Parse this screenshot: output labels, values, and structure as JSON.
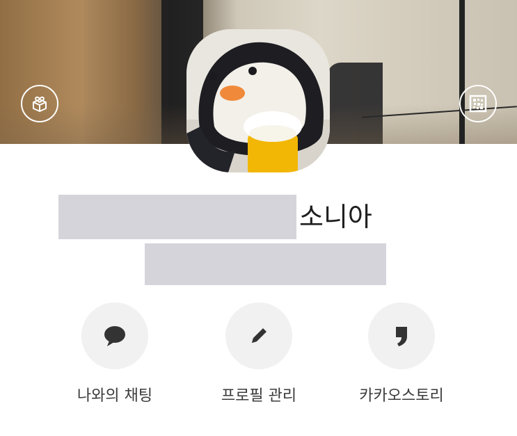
{
  "profile": {
    "name_suffix": "소니아"
  },
  "cover": {
    "left_icon": "gift-icon",
    "right_icon": "qr-code-icon"
  },
  "actions": [
    {
      "label": "나와의 채팅",
      "icon": "chat-bubble-icon"
    },
    {
      "label": "프로필 관리",
      "icon": "pencil-icon"
    },
    {
      "label": "카카오스토리",
      "icon": "kakaostory-icon"
    }
  ],
  "colors": {
    "redaction": "#d5d4db",
    "action_circle": "#f1f1f2",
    "icon_dark": "#333333",
    "beak": "#f08a3a",
    "beer": "#f2b705"
  }
}
